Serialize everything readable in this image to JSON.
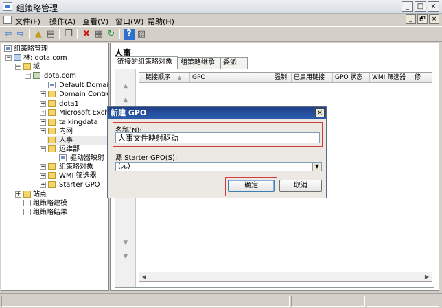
{
  "window": {
    "title": "组策略管理",
    "buttons": {
      "minimize": "_",
      "maximize": "□",
      "close": "×"
    }
  },
  "menubar": {
    "items": [
      "文件(F)",
      "操作(A)",
      "查看(V)",
      "窗口(W)",
      "帮助(H)"
    ],
    "mdi_buttons": {
      "minimize": "_",
      "restore": "🗗",
      "close": "×"
    }
  },
  "toolbar": {
    "icons": [
      "back-icon",
      "forward-icon",
      "up-icon",
      "show-hide-tree-icon",
      "copy-icon",
      "delete-icon",
      "properties-icon",
      "refresh-icon",
      "help-icon",
      "show-pane-icon"
    ],
    "glyphs": {
      "back": "⇦",
      "forward": "⇨",
      "up": "▲",
      "tree": "▤",
      "copy": "❐",
      "delete": "✖",
      "properties": "▦",
      "refresh": "↻",
      "help": "?",
      "pane": "▧"
    }
  },
  "tree": {
    "items": [
      {
        "label": "组策略管理",
        "icon": "gpm-icon",
        "expander": ""
      },
      {
        "label": "林: dota.com",
        "icon": "forest-icon",
        "expander": "−"
      },
      {
        "label": "域",
        "icon": "folder-icon",
        "expander": "−"
      },
      {
        "label": "dota.com",
        "icon": "domain-icon",
        "expander": "−"
      },
      {
        "label": "Default Domain",
        "icon": "gpo-link-icon",
        "expander": ""
      },
      {
        "label": "Domain Control",
        "icon": "folder-icon",
        "expander": "+"
      },
      {
        "label": "dota1",
        "icon": "folder-icon",
        "expander": "+"
      },
      {
        "label": "Microsoft Exch",
        "icon": "folder-icon",
        "expander": "+"
      },
      {
        "label": "talkingdata",
        "icon": "folder-icon",
        "expander": "+"
      },
      {
        "label": "内网",
        "icon": "folder-icon",
        "expander": "+"
      },
      {
        "label": "人事",
        "icon": "folder-icon",
        "expander": ""
      },
      {
        "label": "运维部",
        "icon": "folder-icon",
        "expander": "−"
      },
      {
        "label": "驱动器映射",
        "icon": "gpo-link-icon",
        "expander": ""
      },
      {
        "label": "组策略对象",
        "icon": "folder-icon",
        "expander": "+"
      },
      {
        "label": "WMI 筛选器",
        "icon": "folder-icon",
        "expander": "+"
      },
      {
        "label": "Starter GPO",
        "icon": "folder-icon",
        "expander": "+"
      },
      {
        "label": "站点",
        "icon": "sites-icon",
        "expander": "+"
      },
      {
        "label": "组策略建模",
        "icon": "modeling-icon",
        "expander": ""
      },
      {
        "label": "组策略结果",
        "icon": "results-icon",
        "expander": ""
      }
    ]
  },
  "main": {
    "title": "人事",
    "tabs": [
      {
        "label": "链接的组策略对象",
        "active": true
      },
      {
        "label": "组策略继承",
        "active": false
      },
      {
        "label": "委派",
        "active": false
      }
    ],
    "columns": [
      "链接顺序",
      "GPO",
      "强制",
      "已启用链接",
      "GPO 状态",
      "WMI 筛选器",
      "修"
    ],
    "sort_glyph": "▲",
    "order_glyphs": {
      "top": "▲",
      "up": "▲",
      "down": "▼",
      "bottom": "▼"
    },
    "hscroll_glyphs": {
      "left": "◀",
      "right": "▶"
    }
  },
  "dialog": {
    "title": "新建 GPO",
    "close": "×",
    "name_label": "名称(N):",
    "name_value": "人事文件映射驱动",
    "starter_label": "源 Starter GPO(S):",
    "starter_value": "(无)",
    "dropdown_glyph": "▼",
    "ok_label": "确定",
    "cancel_label": "取消"
  },
  "colors": {
    "highlight_box": "#d23b3b",
    "dialog_title_bg": "#1f3f8a"
  }
}
